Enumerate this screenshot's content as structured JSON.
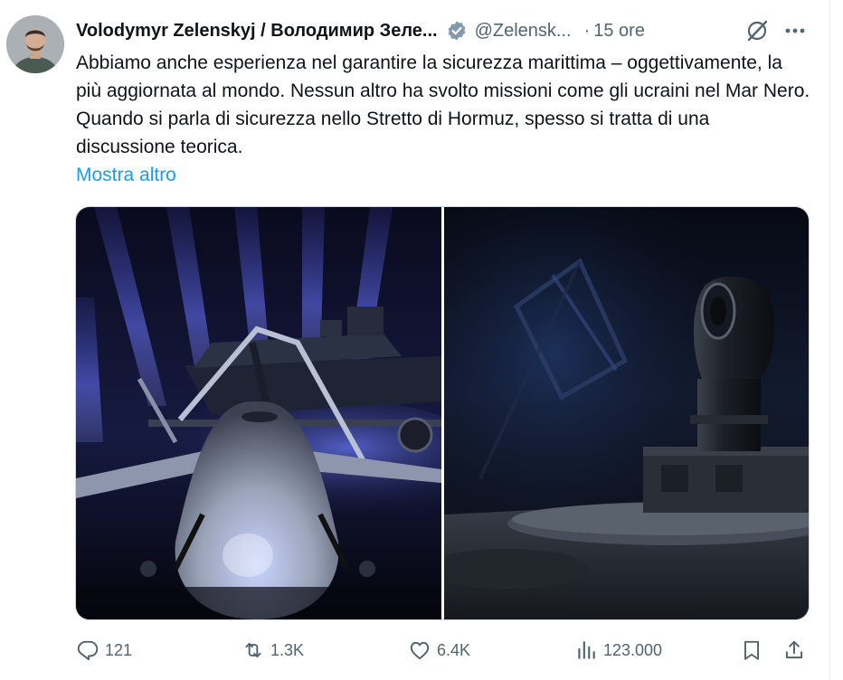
{
  "tweet": {
    "author_name": "Volodymyr Zelenskyj / Володимир Зеле...",
    "handle": "@Zelensk...",
    "time_separator": "·",
    "time": "15 ore",
    "text": "Abbiamo anche esperienza nel garantire la sicurezza marittima – oggettivamente, la più aggiornata al mondo. Nessun altro ha svolto missioni come gli ucraini nel Mar Nero. Quando si parla di sicurezza nello Stretto di Hormuz, spesso si tratta di una discussione teorica.",
    "show_more": "Mostra altro",
    "verified_color": "#829aab",
    "link_color": "#1d9bf0",
    "media": [
      {
        "description": "white unmanned aerial drone in front of a naval drone boat, blue spotlights",
        "name": "drone-photo"
      },
      {
        "description": "camera turret sensor mounted on a naval platform, dark background",
        "name": "camera-turret-photo"
      }
    ]
  },
  "actions": {
    "reply_count": "121",
    "repost_count": "1.3K",
    "like_count": "6.4K",
    "views_count": "123.000",
    "reply_icon": "reply-icon",
    "repost_icon": "repost-icon",
    "like_icon": "heart-icon",
    "views_icon": "views-icon",
    "bookmark_icon": "bookmark-icon",
    "share_icon": "share-icon"
  },
  "colors": {
    "text_primary": "#0f1419",
    "text_secondary": "#536471",
    "border": "#cfd9de"
  }
}
